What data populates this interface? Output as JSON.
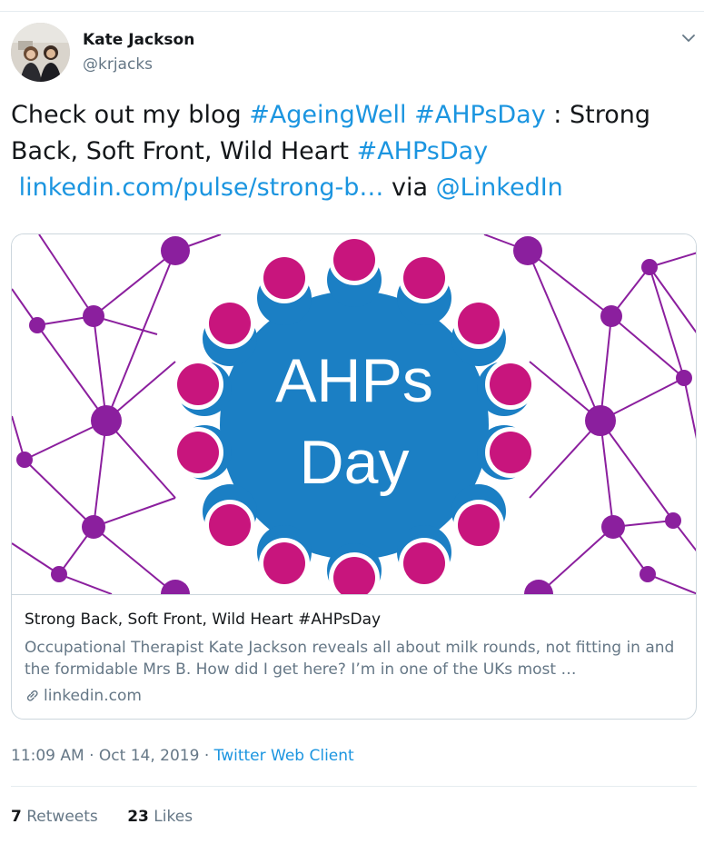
{
  "author": {
    "name": "Kate Jackson",
    "handle": "@krjacks"
  },
  "tweet": {
    "text_1": "Check out my blog ",
    "hashtag_1": "#AgeingWell",
    "space_1": " ",
    "hashtag_2": "#AHPsDay",
    "text_2": " : Strong Back, Soft Front, Wild Heart ",
    "hashtag_3": "#AHPsDay",
    "link": "linkedin.com/pulse/strong-b…",
    "text_3": " via ",
    "mention": "@LinkedIn"
  },
  "card": {
    "image_text_line1": "AHPs",
    "image_text_line2": "Day",
    "title": "Strong Back, Soft Front, Wild Heart #AHPsDay",
    "description": "Occupational Therapist Kate Jackson reveals all about milk rounds, not fitting in and the formidable Mrs B. How did I get here? I’m in one of the UKs most …",
    "domain": "linkedin.com"
  },
  "meta": {
    "time": "11:09 AM",
    "sep1": " · ",
    "date": "Oct 14, 2019",
    "sep2": " · ",
    "client": "Twitter Web Client"
  },
  "stats": {
    "retweets_count": "7",
    "retweets_label": "Retweets",
    "likes_count": "23",
    "likes_label": "Likes"
  },
  "colors": {
    "link": "#1b95e0",
    "gear_blue": "#1b7fc4",
    "magenta": "#c8157d",
    "purple": "#8b1f9e"
  }
}
